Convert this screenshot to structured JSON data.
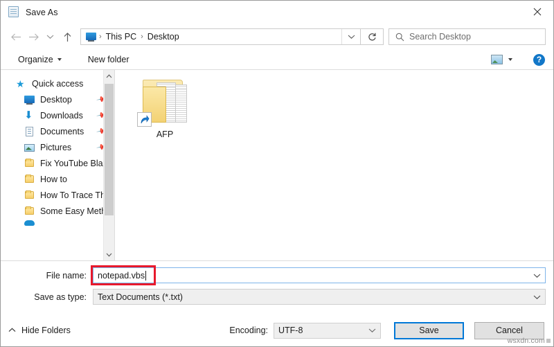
{
  "window": {
    "title": "Save As",
    "icon": "notepad-icon",
    "close_label": "✕"
  },
  "nav": {
    "back_icon": "arrow-left-icon",
    "forward_icon": "arrow-right-icon",
    "recent_icon": "chevron-down-icon",
    "up_icon": "arrow-up-icon",
    "breadcrumb": {
      "icon": "this-pc-icon",
      "items": [
        "This PC",
        "Desktop"
      ],
      "separator": "›"
    },
    "address_dropdown_icon": "chevron-down-icon",
    "refresh_icon": "refresh-icon",
    "search": {
      "icon": "search-icon",
      "placeholder": "Search Desktop",
      "value": ""
    }
  },
  "commandbar": {
    "organize_label": "Organize",
    "organize_caret": "caret-down-icon",
    "new_folder_label": "New folder",
    "view_icon": "view-layout-icon",
    "view_caret_icon": "chevron-down-icon",
    "help_icon": "help-icon",
    "help_glyph": "?"
  },
  "navpane": {
    "items": [
      {
        "label": "Quick access",
        "icon": "star-icon",
        "pinned": false,
        "indent": false
      },
      {
        "label": "Desktop",
        "icon": "desktop-icon",
        "pinned": true,
        "indent": true
      },
      {
        "label": "Downloads",
        "icon": "downloads-icon",
        "pinned": true,
        "indent": true
      },
      {
        "label": "Documents",
        "icon": "documents-icon",
        "pinned": true,
        "indent": true
      },
      {
        "label": "Pictures",
        "icon": "pictures-icon",
        "pinned": true,
        "indent": true
      },
      {
        "label": "Fix YouTube Blac",
        "icon": "folder-icon",
        "pinned": false,
        "indent": true
      },
      {
        "label": "How to",
        "icon": "folder-icon",
        "pinned": false,
        "indent": true
      },
      {
        "label": "How To Trace Th",
        "icon": "folder-icon",
        "pinned": false,
        "indent": true
      },
      {
        "label": "Some Easy Meth",
        "icon": "folder-icon",
        "pinned": false,
        "indent": true
      }
    ],
    "scrollbar": {
      "up_arrow": "⌃",
      "down_arrow": "⌄"
    }
  },
  "filepane": {
    "items": [
      {
        "label": "AFP",
        "icon": "folder-shortcut-icon"
      }
    ]
  },
  "form": {
    "filename_label": "File name:",
    "filename_value": "notepad.vbs",
    "filename_caret_icon": "chevron-down-icon",
    "savetype_label": "Save as type:",
    "savetype_value": "Text Documents (*.txt)",
    "savetype_caret_icon": "chevron-down-icon",
    "highlight_color": "#e8192c"
  },
  "footer": {
    "hide_folders_label": "Hide Folders",
    "hide_folders_icon": "chevron-up-icon",
    "encoding_label": "Encoding:",
    "encoding_value": "UTF-8",
    "encoding_caret_icon": "chevron-down-icon",
    "save_label": "Save",
    "cancel_label": "Cancel",
    "focus_color": "#0078d7"
  },
  "watermark": {
    "text": "wsxdn.com"
  }
}
